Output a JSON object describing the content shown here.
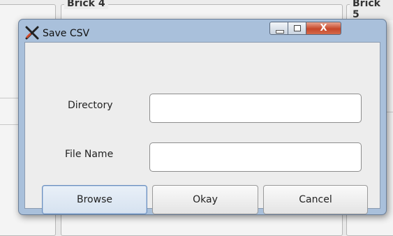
{
  "background": {
    "panel_left_title": "Brick 4",
    "panel_right_title": "Brick 5"
  },
  "dialog": {
    "title": "Save CSV",
    "icon": "crossed-tools-icon",
    "window_buttons": {
      "minimize": "minimize-icon",
      "maximize": "maximize-icon",
      "close_label": "X"
    },
    "fields": {
      "directory_label": "Directory",
      "directory_value": "",
      "filename_label": "File Name",
      "filename_value": ""
    },
    "buttons": {
      "browse": "Browse",
      "okay": "Okay",
      "cancel": "Cancel"
    }
  }
}
